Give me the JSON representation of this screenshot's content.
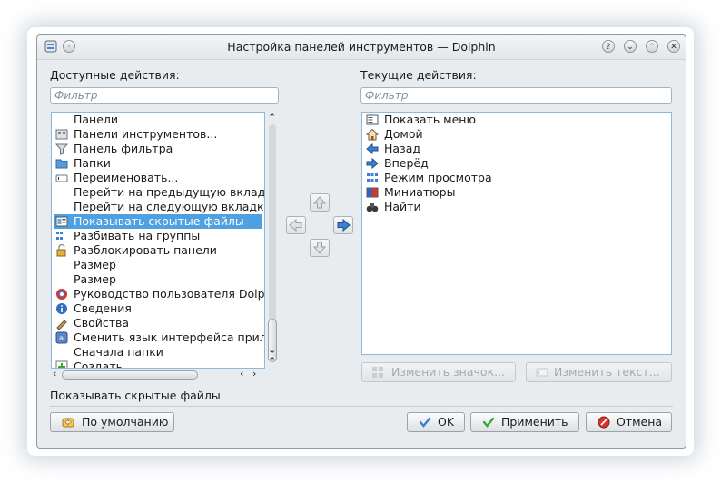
{
  "window": {
    "title": "Настройка панелей инструментов — Dolphin",
    "title_buttons": [
      "?",
      "⌄",
      "⌃",
      "✕"
    ]
  },
  "available": {
    "label": "Доступные действия:",
    "filter_placeholder": "Фильтр",
    "items": [
      {
        "label": "Панели",
        "icon": "none-icon"
      },
      {
        "label": "Панели инструментов...",
        "icon": "toolbar-config-icon"
      },
      {
        "label": "Панель фильтра",
        "icon": "filter-icon"
      },
      {
        "label": "Папки",
        "icon": "folder-icon"
      },
      {
        "label": "Переименовать...",
        "icon": "rename-icon"
      },
      {
        "label": "Перейти на предыдущую вклад",
        "icon": "none-icon"
      },
      {
        "label": "Перейти на следующую вкладку",
        "icon": "none-icon"
      },
      {
        "label": "Показывать скрытые файлы",
        "icon": "hidden-files-icon"
      },
      {
        "label": "Разбивать на группы",
        "icon": "group-icon"
      },
      {
        "label": "Разблокировать панели",
        "icon": "unlock-icon"
      },
      {
        "label": "Размер",
        "icon": "none-icon"
      },
      {
        "label": "Размер",
        "icon": "none-icon"
      },
      {
        "label": "Руководство пользователя Dolph",
        "icon": "help-icon"
      },
      {
        "label": "Сведения",
        "icon": "info-icon"
      },
      {
        "label": "Свойства",
        "icon": "properties-icon"
      },
      {
        "label": "Сменить язык интерфейса прил",
        "icon": "language-icon"
      },
      {
        "label": "Сначала папки",
        "icon": "none-icon"
      },
      {
        "label": "Создать",
        "icon": "new-icon"
      }
    ],
    "selected_index": 7
  },
  "current": {
    "label": "Текущие действия:",
    "filter_placeholder": "Фильтр",
    "items": [
      {
        "label": "Показать меню",
        "icon": "menu-icon"
      },
      {
        "label": "Домой",
        "icon": "home-icon"
      },
      {
        "label": "Назад",
        "icon": "back-icon"
      },
      {
        "label": "Вперёд",
        "icon": "forward-icon"
      },
      {
        "label": "Режим просмотра",
        "icon": "view-mode-icon"
      },
      {
        "label": "Миниатюры",
        "icon": "thumbnails-icon"
      },
      {
        "label": "Найти",
        "icon": "find-icon"
      }
    ],
    "change_icon_label": "Изменить значок...",
    "change_text_label": "Изменить текст..."
  },
  "status_text": "Показывать скрытые файлы",
  "buttons": {
    "defaults": "По умолчанию",
    "ok": "OK",
    "apply": "Применить",
    "cancel": "Отмена"
  },
  "colors": {
    "selection": "#4fa0e0",
    "list_border": "#8fb8dd",
    "window_bg": "#e9ecee"
  }
}
